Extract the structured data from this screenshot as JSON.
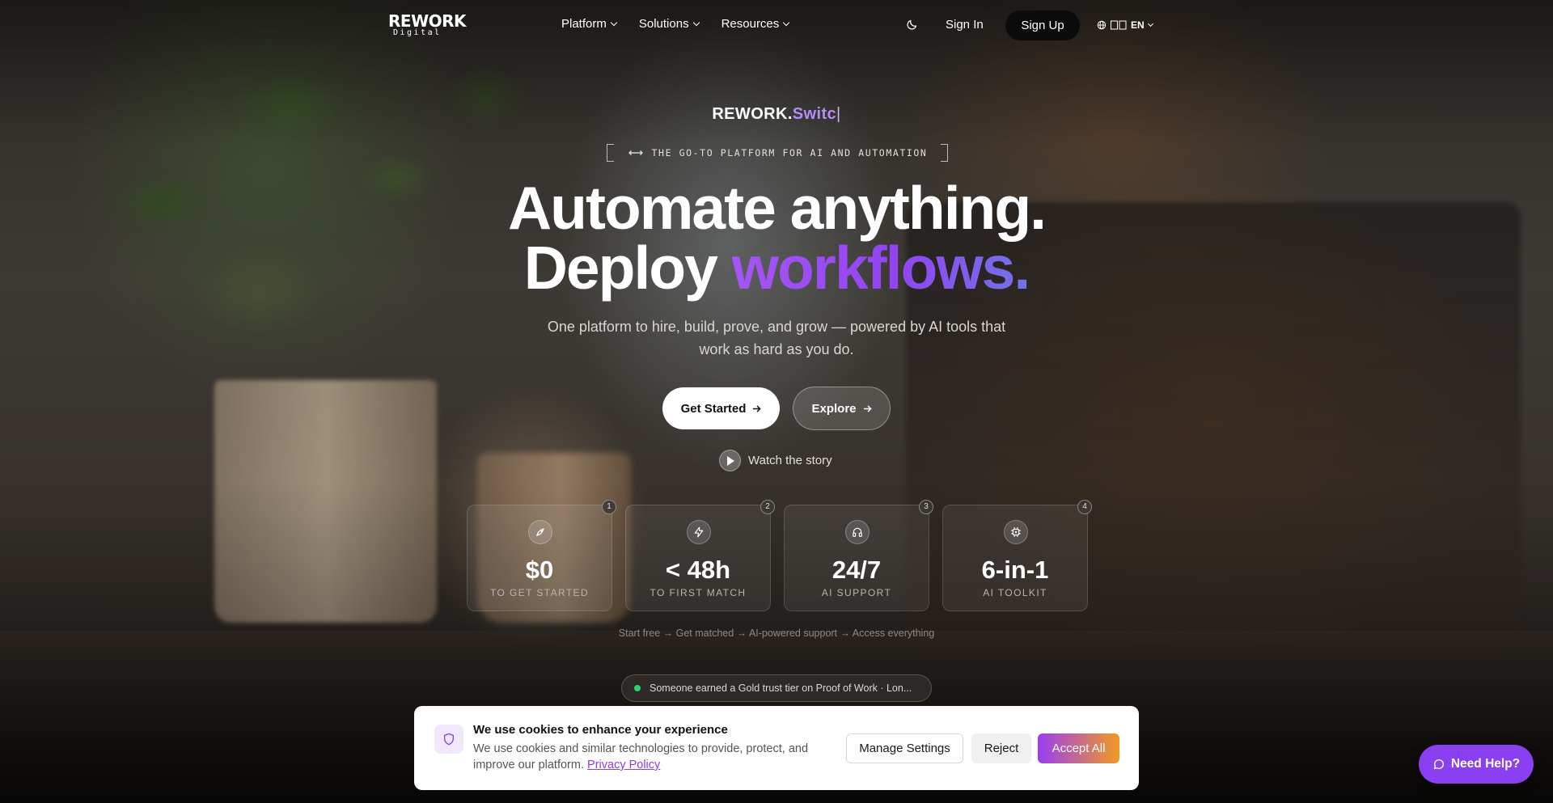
{
  "nav": {
    "logo_line1": "REWORK",
    "logo_line2": "Digital",
    "menu": [
      {
        "label": "Platform"
      },
      {
        "label": "Solutions"
      },
      {
        "label": "Resources"
      }
    ],
    "sign_in": "Sign In",
    "sign_up": "Sign Up",
    "language": "EN",
    "icons": {
      "theme": "moon-icon",
      "language": "globe-icon",
      "flag": "flag-icon"
    }
  },
  "hero": {
    "rotator_prefix": "REWORK.",
    "rotator_accent": "Switc",
    "rotator_caret": "|",
    "tagline": "THE GO-TO PLATFORM FOR AI AND AUTOMATION",
    "headline_line1": "Automate anything.",
    "headline_line2_plain": "Deploy ",
    "headline_line2_accent": "workflows.",
    "subtitle": "One platform to hire, build, prove, and grow — powered by AI tools that work as hard as you do.",
    "cta_primary": "Get Started",
    "cta_secondary": "Explore",
    "watch_label": "Watch the story"
  },
  "stats": [
    {
      "step": "1",
      "value": "$0",
      "label": "TO GET STARTED",
      "icon": "rocket-icon"
    },
    {
      "step": "2",
      "value": "< 48h",
      "label": "TO FIRST MATCH",
      "icon": "lightning-icon"
    },
    {
      "step": "3",
      "value": "24/7",
      "label": "AI SUPPORT",
      "icon": "headphones-icon"
    },
    {
      "step": "4",
      "value": "6-in-1",
      "label": "AI TOOLKIT",
      "icon": "chip-icon"
    }
  ],
  "journey": "Start free → Get matched → AI-powered support → Access everything",
  "ticker": "Someone earned a Gold trust tier on Proof of Work · Lon...",
  "cookie": {
    "title": "We use cookies to enhance your experience",
    "description": "We use cookies and similar technologies to provide, protect, and improve our platform.",
    "policy_link": "Privacy Policy",
    "manage": "Manage Settings",
    "reject": "Reject",
    "accept": "Accept All"
  },
  "help_button": "Need Help?",
  "colors": {
    "accent_purple": "#9244f0",
    "accept_gradient_start": "#9a3df2",
    "accept_gradient_end": "#f29a22",
    "live_dot": "#2fd06b"
  }
}
